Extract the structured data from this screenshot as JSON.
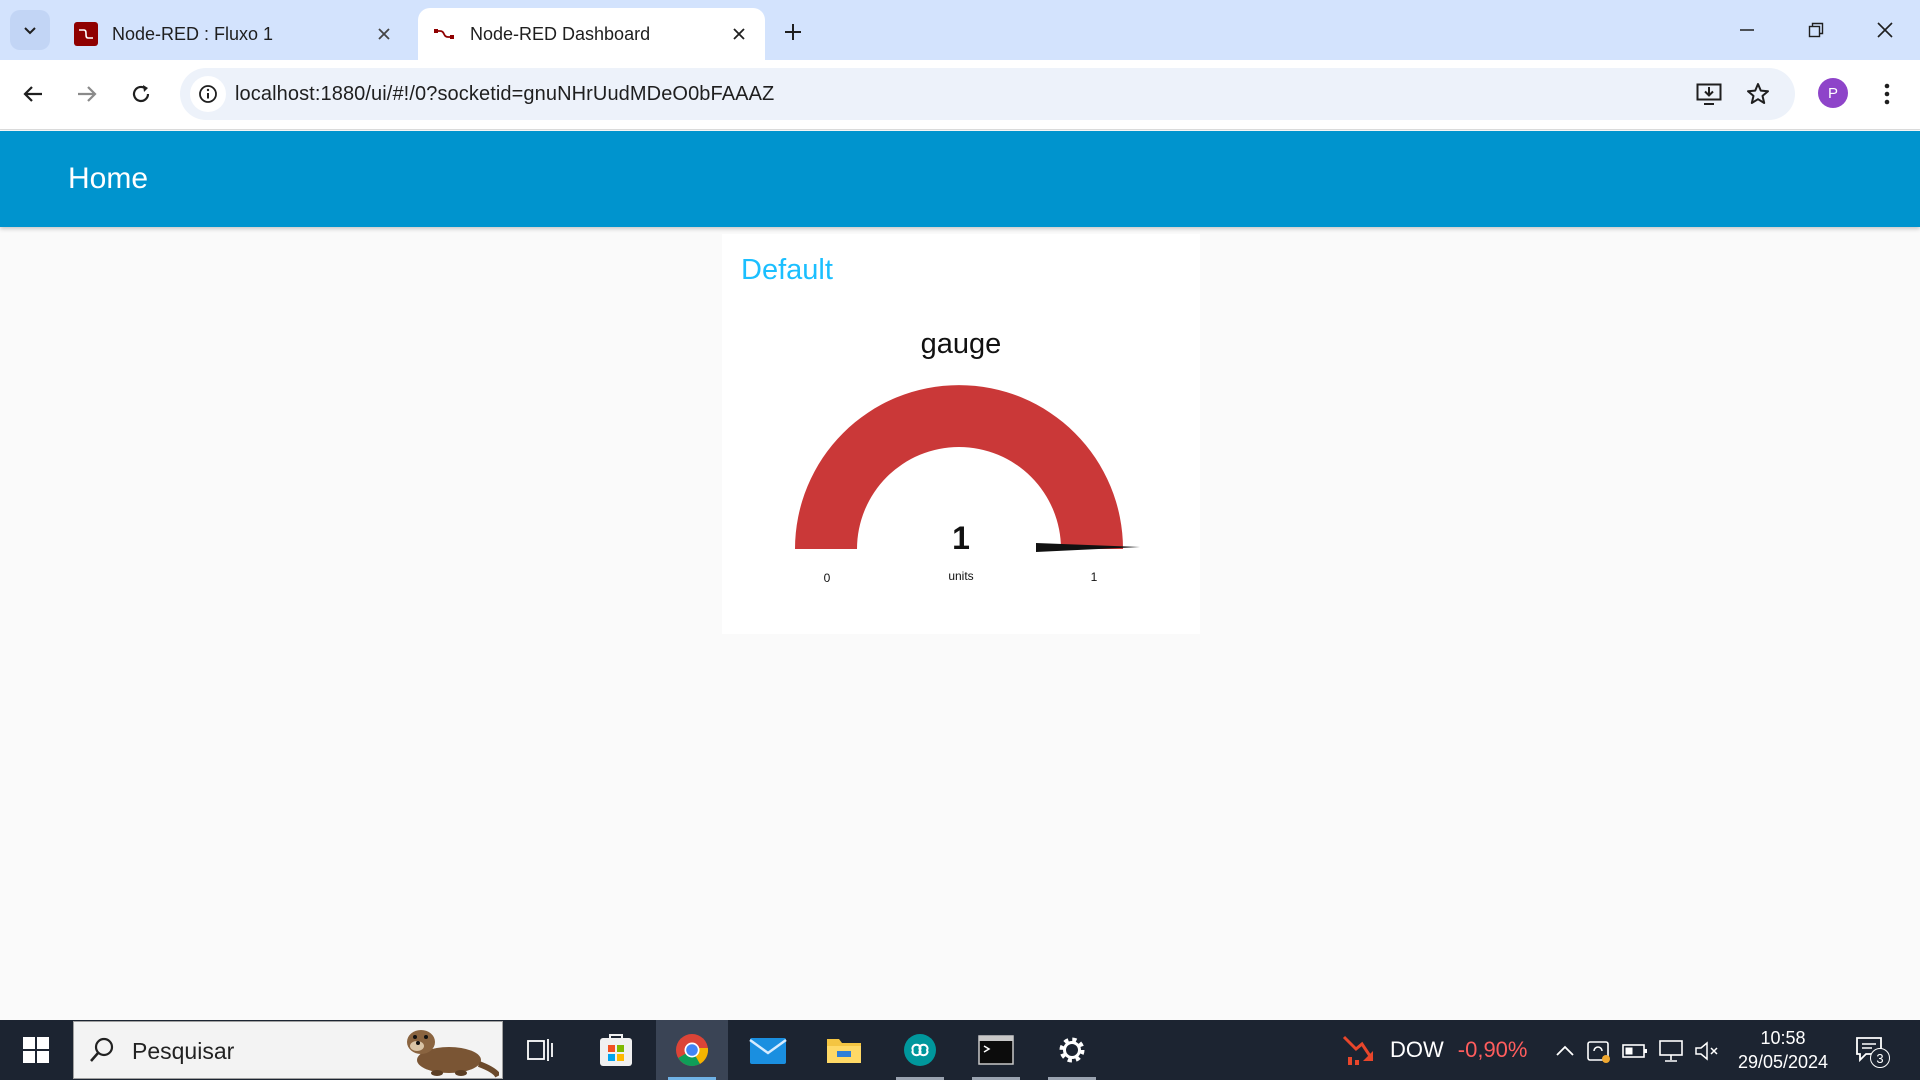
{
  "browser": {
    "tabs": [
      {
        "title": "Node-RED : Fluxo 1",
        "active": false
      },
      {
        "title": "Node-RED Dashboard",
        "active": true
      }
    ],
    "url": "localhost:1880/ui/#!/0?socketid=gnuNHrUudMDeO0bFAAAZ",
    "profile_initial": "P"
  },
  "dashboard": {
    "page_title": "Home",
    "group_title": "Default",
    "gauge": {
      "title": "gauge",
      "value": "1",
      "units": "units",
      "min": "0",
      "max": "1",
      "fill_fraction": 1.0,
      "color": "#ca3838"
    },
    "colors": {
      "header": "#0094ce",
      "group_title": "#1bbfff"
    }
  },
  "taskbar": {
    "search_placeholder": "Pesquisar",
    "apps": [
      "task-view",
      "microsoft-store",
      "chrome",
      "mail",
      "file-explorer",
      "arduino",
      "terminal",
      "settings"
    ],
    "stock": {
      "name": "DOW",
      "change": "-0,90%"
    },
    "time": "10:58",
    "date": "29/05/2024",
    "notifications": "3"
  }
}
